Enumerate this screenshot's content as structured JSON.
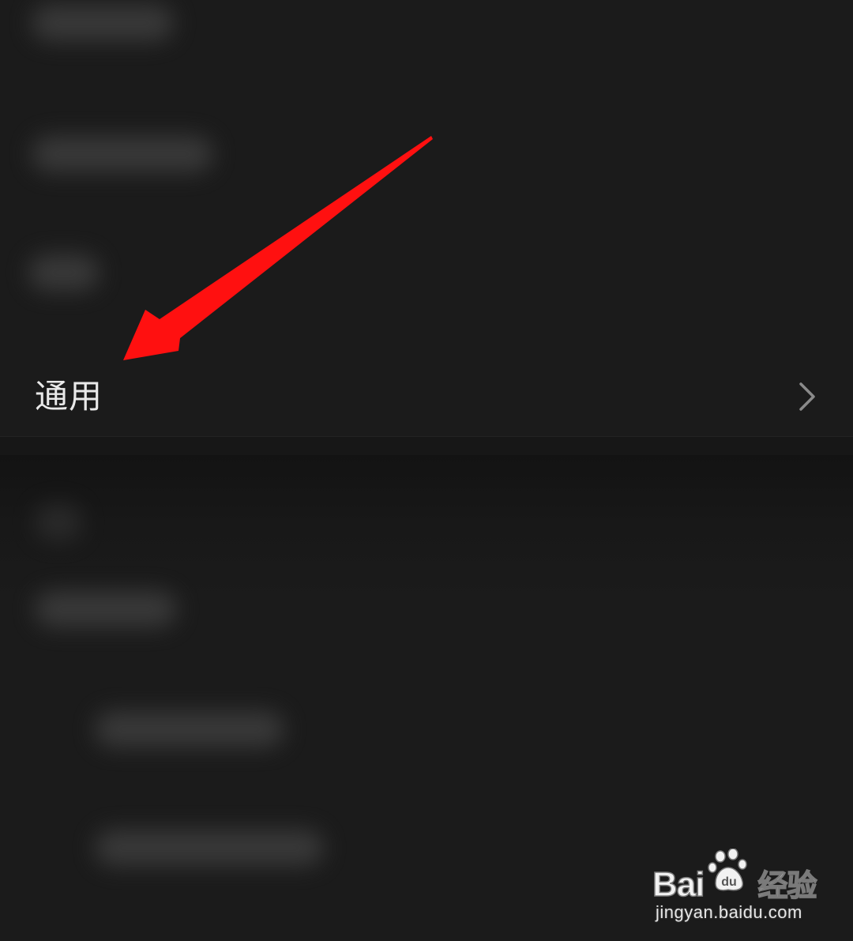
{
  "settings": {
    "general_label": "通用",
    "chevron_icon": "chevron-right-icon"
  },
  "annotation": {
    "arrow_color": "#ff1010",
    "arrow_icon": "red-arrow-icon"
  },
  "watermark": {
    "logo_text_left": "Bai",
    "logo_text_right": "经验",
    "logo_du": "du",
    "url": "jingyan.baidu.com"
  },
  "colors": {
    "background": "#1b1b1b",
    "text": "#e9e9e9",
    "chevron": "#8a8a8a"
  }
}
